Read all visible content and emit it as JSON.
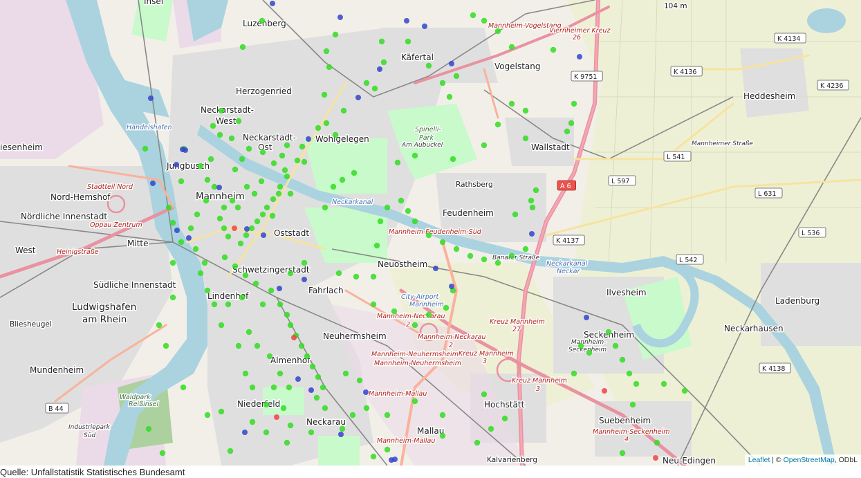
{
  "map": {
    "places": [
      {
        "id": "insel",
        "text": "Insel",
        "size": "m"
      },
      {
        "id": "luzenberg",
        "text": "Luzenberg",
        "size": "m"
      },
      {
        "id": "kaefertal",
        "text": "Käfertal",
        "size": "m"
      },
      {
        "id": "mannheim-vogelstang-st",
        "text": "Mannheim-Vogelstang",
        "size": "red"
      },
      {
        "id": "viernheimer-kreuz",
        "text": "Viernheimer Kreuz",
        "size": "red"
      },
      {
        "id": "vk-26",
        "text": "26",
        "size": "red"
      },
      {
        "id": "vogelstang",
        "text": "Vogelstang",
        "size": "m"
      },
      {
        "id": "herzogenried",
        "text": "Herzogenried",
        "size": "m"
      },
      {
        "id": "heddesheim",
        "text": "Heddesheim",
        "size": "m"
      },
      {
        "id": "neckarstadt-west-1",
        "text": "Neckarstadt-",
        "size": "m"
      },
      {
        "id": "neckarstadt-west-2",
        "text": "West",
        "size": "m"
      },
      {
        "id": "neckarstadt-ost-1",
        "text": "Neckarstadt-",
        "size": "m"
      },
      {
        "id": "neckarstadt-ost-2",
        "text": "Ost",
        "size": "m"
      },
      {
        "id": "wohlgelegen",
        "text": "Wohlgelegen",
        "size": "m"
      },
      {
        "id": "handelshafen",
        "text": "Handelshafen",
        "size": "blue"
      },
      {
        "id": "friesenheim",
        "text": "iesenheim",
        "size": "m"
      },
      {
        "id": "spinelli-1",
        "text": "Spinelli-",
        "size": "green"
      },
      {
        "id": "spinelli-2",
        "text": "Park",
        "size": "green"
      },
      {
        "id": "am-aubuckel",
        "text": "Am Aubuckel",
        "size": "dark"
      },
      {
        "id": "wallstadt",
        "text": "Wallstadt",
        "size": "m"
      },
      {
        "id": "mannheimer-strasse",
        "text": "Mannheimer Straße",
        "size": "dark"
      },
      {
        "id": "jungbusch",
        "text": "Jungbusch",
        "size": "m"
      },
      {
        "id": "stadtteilnord",
        "text": "Stadtteil Nord",
        "size": "red"
      },
      {
        "id": "mannheim",
        "text": "Mannheim",
        "size": "l"
      },
      {
        "id": "rathsberg",
        "text": "Rathsberg",
        "size": "s"
      },
      {
        "id": "nord-hemshof",
        "text": "Nord-Hemshof",
        "size": "m"
      },
      {
        "id": "noerdliche-innenstadt",
        "text": "Nördliche Innenstadt",
        "size": "m"
      },
      {
        "id": "oppau-zentrum",
        "text": "Oppau Zentrum",
        "size": "red"
      },
      {
        "id": "feudenheim",
        "text": "Feudenheim",
        "size": "m"
      },
      {
        "id": "neckarkanal-1",
        "text": "Neckarkanal",
        "size": "blue"
      },
      {
        "id": "mannheim-feudenheim-sued",
        "text": "Mannheim-Feudenheim-Süd",
        "size": "red"
      },
      {
        "id": "oststadt",
        "text": "Oststadt",
        "size": "m"
      },
      {
        "id": "mitte",
        "text": "Mitte",
        "size": "m"
      },
      {
        "id": "west",
        "text": "West",
        "size": "m"
      },
      {
        "id": "heinigstrasse",
        "text": "Heinigstraße",
        "size": "red"
      },
      {
        "id": "banater-strasse",
        "text": "Banater Straße",
        "size": "dark"
      },
      {
        "id": "neuostheim",
        "text": "Neuostheim",
        "size": "m"
      },
      {
        "id": "neckarkanal-2",
        "text": "Neckarkanal",
        "size": "blue"
      },
      {
        "id": "neckar",
        "text": "Neckar",
        "size": "blue"
      },
      {
        "id": "ladenburg",
        "text": "Ladenburg",
        "size": "m"
      },
      {
        "id": "schwetzingerstadt",
        "text": "Schwetzingerstadt",
        "size": "m"
      },
      {
        "id": "suedliche-innenstadt",
        "text": "Südliche Innenstadt",
        "size": "m"
      },
      {
        "id": "fahrlach",
        "text": "Fahrlach",
        "size": "m"
      },
      {
        "id": "city-airport-1",
        "text": "City-Airport",
        "size": "blue"
      },
      {
        "id": "city-airport-2",
        "text": "Mannheim",
        "size": "blue"
      },
      {
        "id": "lindenhof",
        "text": "Lindenhof",
        "size": "m"
      },
      {
        "id": "ilvesheim",
        "text": "Ilvesheim",
        "size": "m"
      },
      {
        "id": "ludwigshafen-1",
        "text": "Ludwigshafen",
        "size": "l"
      },
      {
        "id": "ludwigshafen-2",
        "text": "am Rhein",
        "size": "l"
      },
      {
        "id": "mannheim-neckarau-2a",
        "text": "Mannheim-Neckarau",
        "size": "red"
      },
      {
        "id": "mannheim-neckarau-2b",
        "text": "2",
        "size": "red"
      },
      {
        "id": "kreuz-mannheim-27a",
        "text": "Kreuz Mannheim",
        "size": "red"
      },
      {
        "id": "kreuz-mannheim-27b",
        "text": "27",
        "size": "red"
      },
      {
        "id": "bliesheugel",
        "text": "Bliesheugel",
        "size": "s"
      },
      {
        "id": "neuhermsheim",
        "text": "Neuhermsheim",
        "size": "m"
      },
      {
        "id": "mannheim-neckarau-2c",
        "text": "Mannheim-Neckarau",
        "size": "red"
      },
      {
        "id": "mannheim-neckarau-2d",
        "text": "2",
        "size": "red"
      },
      {
        "id": "seckenheim",
        "text": "Seckenheim",
        "size": "m"
      },
      {
        "id": "mannheim-seckenheim-1",
        "text": "Mannheim-",
        "size": "dark"
      },
      {
        "id": "mannheim-seckenheim-2",
        "text": "Seckenheim",
        "size": "dark"
      },
      {
        "id": "neckarhausen",
        "text": "Neckarhausen",
        "size": "m"
      },
      {
        "id": "mannheim-neuhermsheim-1",
        "text": "Mannheim-Neuhermsheim",
        "size": "red"
      },
      {
        "id": "mannheim-neuhermsheim-2",
        "text": "Mannheim-Neuhermsheim",
        "size": "red"
      },
      {
        "id": "kreuz-mannheim-3a",
        "text": "Kreuz Mannheim",
        "size": "red"
      },
      {
        "id": "kreuz-mannheim-3b",
        "text": "3",
        "size": "red"
      },
      {
        "id": "almenhof",
        "text": "Almenhof",
        "size": "m"
      },
      {
        "id": "mundenheim",
        "text": "Mundenheim",
        "size": "m"
      },
      {
        "id": "kreuz-mannheim-3c",
        "text": "Kreuz Mannheim",
        "size": "red"
      },
      {
        "id": "kreuz-mannheim-3d",
        "text": "3",
        "size": "red"
      },
      {
        "id": "waldpark",
        "text": "Waldpark",
        "size": "green"
      },
      {
        "id": "reissinsel",
        "text": "Reißinsel",
        "size": "green"
      },
      {
        "id": "mannheim-mallau",
        "text": "Mannheim-Mallau",
        "size": "red"
      },
      {
        "id": "hochstaett",
        "text": "Hochstätt",
        "size": "m"
      },
      {
        "id": "niederfeld",
        "text": "Niederfeld",
        "size": "m"
      },
      {
        "id": "suebenheim",
        "text": "Suebenheim",
        "size": "m"
      },
      {
        "id": "industriepark-1",
        "text": "Industriepark",
        "size": "dark"
      },
      {
        "id": "industriepark-2",
        "text": "Süd",
        "size": "dark"
      },
      {
        "id": "neckarau",
        "text": "Neckarau",
        "size": "m"
      },
      {
        "id": "mallau",
        "text": "Mallau",
        "size": "m"
      },
      {
        "id": "mannheim-seckenheim-4a",
        "text": "Mannheim-Seckenheim",
        "size": "red"
      },
      {
        "id": "mannheim-seckenheim-4b",
        "text": "4",
        "size": "red"
      },
      {
        "id": "mannheim-mallau-2",
        "text": "Mannheim-Mallau",
        "size": "red"
      },
      {
        "id": "kaefertal-s",
        "text": "Kalvarienberg",
        "size": "s"
      },
      {
        "id": "neu-edingen",
        "text": "Neu-Edingen",
        "size": "m"
      },
      {
        "id": "elev-104",
        "text": "104 m",
        "size": "s"
      }
    ],
    "road_shields": [
      {
        "id": "k4134",
        "text": "K 4134"
      },
      {
        "id": "k4136",
        "text": "K 4136"
      },
      {
        "id": "k4236",
        "text": "K 4236"
      },
      {
        "id": "k9751",
        "text": "K 9751"
      },
      {
        "id": "l541",
        "text": "L 541"
      },
      {
        "id": "a6",
        "text": "A 6"
      },
      {
        "id": "l597",
        "text": "L 597"
      },
      {
        "id": "l631",
        "text": "L 631"
      },
      {
        "id": "l536",
        "text": "L 536"
      },
      {
        "id": "k4137",
        "text": "K 4137"
      },
      {
        "id": "l542",
        "text": "L 542"
      },
      {
        "id": "k4138",
        "text": "K 4138"
      },
      {
        "id": "b44",
        "text": "B 44"
      }
    ],
    "marker_colors": {
      "green": "#33dd22",
      "blue": "#3344cc",
      "red": "#ee4444"
    }
  },
  "attribution": {
    "leaflet": "Leaflet",
    "separator": " | © ",
    "osm": "OpenStreetMap",
    "odbl": ", ODbL"
  },
  "source_caption": "Quelle: Unfallstatistik Statistisches Bundesamt"
}
